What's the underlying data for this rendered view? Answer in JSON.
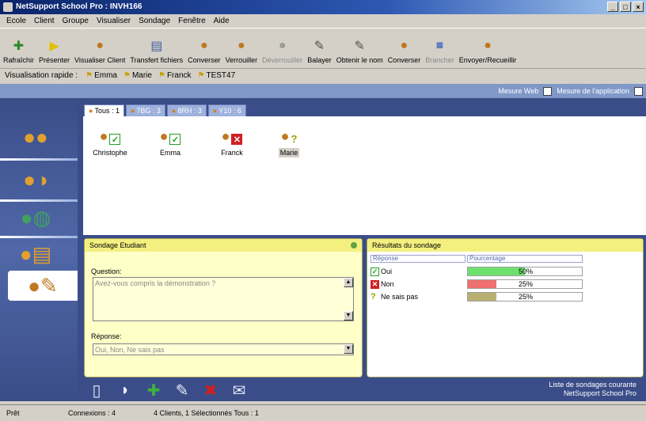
{
  "window": {
    "title": "NetSupport School Pro : INVH166"
  },
  "menu": [
    "Ecole",
    "Client",
    "Groupe",
    "Visualiser",
    "Sondage",
    "Fenêtre",
    "Aide"
  ],
  "toolbar": [
    {
      "label": "Rafraîchir",
      "icon": "refresh-icon",
      "disabled": false
    },
    {
      "label": "Présenter",
      "icon": "present-icon",
      "disabled": false
    },
    {
      "label": "Visualiser Client",
      "icon": "view-client-icon",
      "disabled": false
    },
    {
      "label": "Transfert fichiers",
      "icon": "file-transfer-icon",
      "disabled": false
    },
    {
      "label": "Converser",
      "icon": "chat-icon",
      "disabled": false
    },
    {
      "label": "Verrouiller",
      "icon": "lock-icon",
      "disabled": false
    },
    {
      "label": "Déverrouiller",
      "icon": "unlock-icon",
      "disabled": true
    },
    {
      "label": "Balayer",
      "icon": "scan-icon",
      "disabled": false
    },
    {
      "label": "Obtenir le nom",
      "icon": "get-name-icon",
      "disabled": false
    },
    {
      "label": "Converser",
      "icon": "chat-icon",
      "disabled": false
    },
    {
      "label": "Brancher",
      "icon": "connect-icon",
      "disabled": true
    },
    {
      "label": "Envoyer/Recueillir",
      "icon": "send-collect-icon",
      "disabled": false
    }
  ],
  "quick_view": {
    "label": "Visualisation rapide :",
    "items": [
      "Emma",
      "Marie",
      "Franck",
      "TEST47"
    ]
  },
  "measure": {
    "web": "Mesure Web",
    "app": "Mesure de l'application"
  },
  "tabs": [
    "Tous : 1",
    "7BG : 3",
    "8RH : 3",
    "Y10 : 6"
  ],
  "clients": [
    {
      "name": "Christophe",
      "status": "yes"
    },
    {
      "name": "Emma",
      "status": "yes"
    },
    {
      "name": "Franck",
      "status": "no"
    },
    {
      "name": "Marie",
      "status": "unknown"
    }
  ],
  "poll": {
    "title": "Sondage Etudiant",
    "question_label": "Question:",
    "question_value": "Avez-vous compris la démonstration ?",
    "response_label": "Réponse:",
    "response_value": "Oui, Non, Ne sais pas"
  },
  "results": {
    "title": "Résultats du sondage",
    "col_response": "Réponse",
    "col_percent": "Pourcentage",
    "rows": [
      {
        "label": "Oui",
        "percent": 50,
        "percent_text": "50%",
        "color": "#6ee06e",
        "status": "yes"
      },
      {
        "label": "Non",
        "percent": 25,
        "percent_text": "25%",
        "color": "#f07070",
        "status": "no"
      },
      {
        "label": "Ne sais pas",
        "percent": 25,
        "percent_text": "25%",
        "color": "#b8b070",
        "status": "unknown"
      }
    ]
  },
  "brand": {
    "line1": "Liste de sondages courante",
    "line2": "NetSupport School Pro"
  },
  "status": {
    "ready": "Prêt",
    "connections": "Connexions : 4",
    "summary": "4 Clients, 1 Sélectionnés  Tous : 1"
  }
}
